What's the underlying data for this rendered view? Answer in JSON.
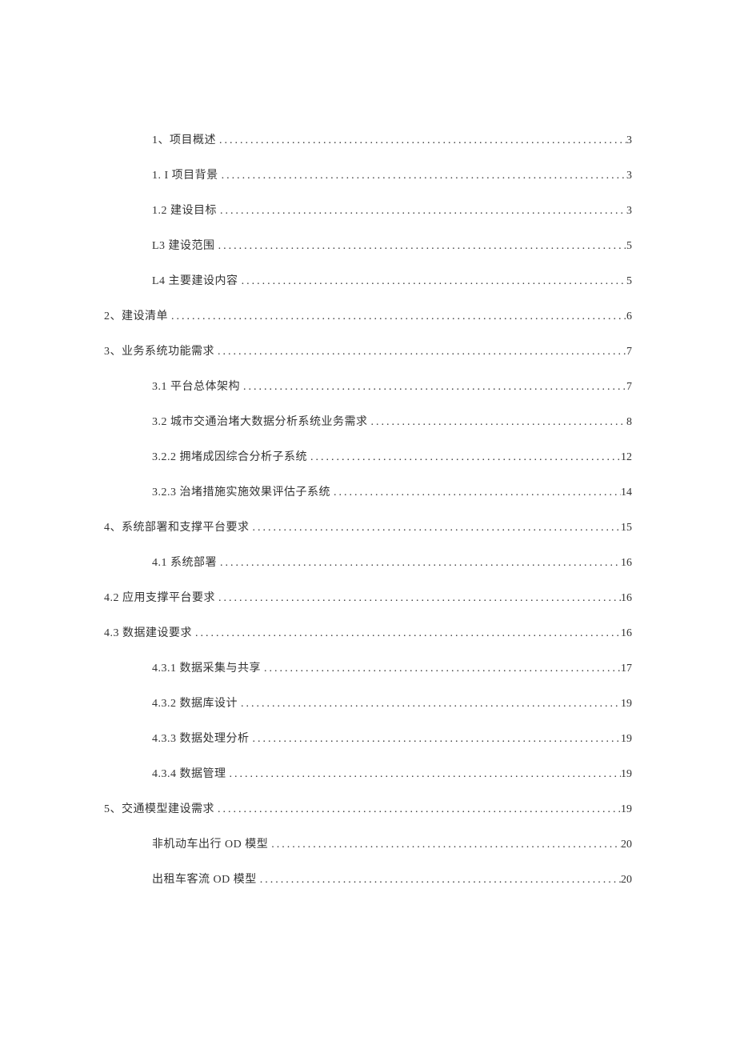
{
  "toc": {
    "entries": [
      {
        "indent": 1,
        "title": "1、项目概述",
        "page": "3"
      },
      {
        "indent": 1,
        "title": "1. I 项目背景",
        "page": "3"
      },
      {
        "indent": 1,
        "title": "1.2 建设目标",
        "page": "3"
      },
      {
        "indent": 1,
        "title": "L3 建设范围",
        "page": "5"
      },
      {
        "indent": 1,
        "title": "L4 主要建设内容",
        "page": "5"
      },
      {
        "indent": 0,
        "title": "2、建设清单",
        "page": "6"
      },
      {
        "indent": 0,
        "title": "3、业务系统功能需求",
        "page": "7"
      },
      {
        "indent": 1,
        "title": "3.1 平台总体架构",
        "page": "7"
      },
      {
        "indent": 1,
        "title": "3.2 城市交通治堵大数据分析系统业务需求",
        "page": "8"
      },
      {
        "indent": 1,
        "title": "3.2.2 拥堵成因综合分析子系统",
        "page": "12"
      },
      {
        "indent": 1,
        "title": "3.2.3 治堵措施实施效果评估子系统",
        "page": "14"
      },
      {
        "indent": 0,
        "title": "4、系统部署和支撑平台要求",
        "page": "15"
      },
      {
        "indent": 1,
        "title": "4.1 系统部署",
        "page": "16"
      },
      {
        "indent": 0,
        "title": "4.2 应用支撑平台要求",
        "page": "16"
      },
      {
        "indent": 0,
        "title": "4.3 数据建设要求",
        "page": "16"
      },
      {
        "indent": 1,
        "title": "4.3.1 数据采集与共享",
        "page": "17"
      },
      {
        "indent": 1,
        "title": "4.3.2 数据库设计",
        "page": "19"
      },
      {
        "indent": 1,
        "title": "4.3.3 数据处理分析",
        "page": "19"
      },
      {
        "indent": 1,
        "title": "4.3.4 数据管理",
        "page": "19"
      },
      {
        "indent": 0,
        "title": "5、交通模型建设需求",
        "page": "19"
      },
      {
        "indent": 1,
        "title": "非机动车出行 OD 模型",
        "page": "20"
      },
      {
        "indent": 1,
        "title": "出租车客流 OD 模型",
        "page": "20"
      }
    ]
  }
}
